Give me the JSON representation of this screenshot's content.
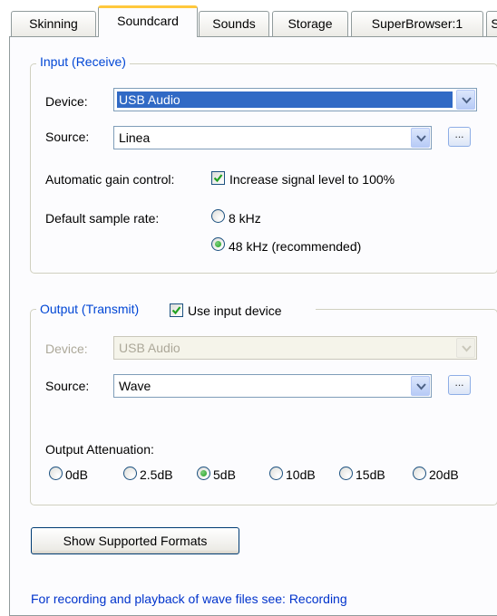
{
  "tabs": [
    {
      "label": "Skinning"
    },
    {
      "label": "Soundcard"
    },
    {
      "label": "Sounds"
    },
    {
      "label": "Storage"
    },
    {
      "label": "SuperBrowser:1"
    },
    {
      "label": "S"
    }
  ],
  "active_tab": "Soundcard",
  "input": {
    "legend": "Input (Receive)",
    "device_label": "Device:",
    "device_value": "USB Audio",
    "source_label": "Source:",
    "source_value": "Linea",
    "source_button": "...",
    "agc_label": "Automatic gain control:",
    "agc_checkbox_label": "Increase signal level to 100%",
    "agc_checked": true,
    "rate_label": "Default sample rate:",
    "rate_options": [
      {
        "label": "8 kHz",
        "selected": false
      },
      {
        "label": "48 kHz (recommended)",
        "selected": true
      }
    ]
  },
  "output": {
    "legend": "Output (Transmit)",
    "use_input_label": "Use input device",
    "use_input_checked": true,
    "device_label": "Device:",
    "device_value": "USB Audio",
    "source_label": "Source:",
    "source_value": "Wave",
    "source_button": "...",
    "attenuation_label": "Output Attenuation:",
    "attenuation_options": [
      {
        "label": "0dB",
        "selected": false
      },
      {
        "label": "2.5dB",
        "selected": false
      },
      {
        "label": "5dB",
        "selected": true
      },
      {
        "label": "10dB",
        "selected": false
      },
      {
        "label": "15dB",
        "selected": false
      },
      {
        "label": "20dB",
        "selected": false
      }
    ]
  },
  "show_formats_button": "Show Supported Formats",
  "footer_text": "For recording and playback of wave files see: Recording",
  "colors": {
    "accent_blue": "#0046d5",
    "selection": "#316ac5",
    "active_tab_highlight": "#ffc83c",
    "radio_dot": "#21a121"
  }
}
